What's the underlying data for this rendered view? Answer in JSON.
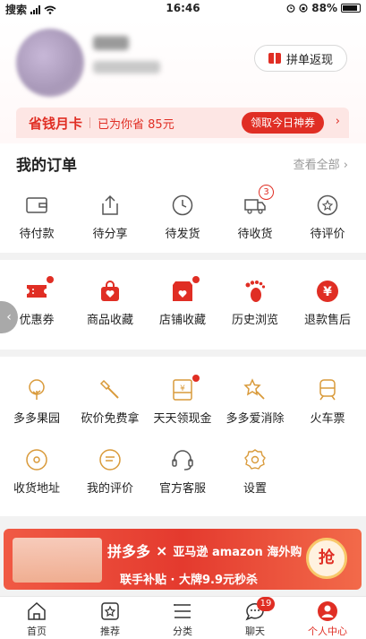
{
  "status": {
    "carrier": "搜索",
    "time": "16:46",
    "battery": "88%"
  },
  "header": {
    "pdd_button": "拼单返现"
  },
  "money_card": {
    "title": "省钱月卡",
    "saved": "已为你省 85元",
    "coupon_button": "领取今日神券",
    "chevron": "›"
  },
  "orders": {
    "title": "我的订单",
    "view_all": "查看全部 ›",
    "items": [
      {
        "label": "待付款",
        "icon": "wallet-icon"
      },
      {
        "label": "待分享",
        "icon": "share-icon"
      },
      {
        "label": "待发货",
        "icon": "clock-icon"
      },
      {
        "label": "待收货",
        "icon": "truck-icon",
        "badge": "3"
      },
      {
        "label": "待评价",
        "icon": "review-icon"
      }
    ]
  },
  "favorites": {
    "items": [
      {
        "label": "优惠券",
        "icon": "coupon-icon"
      },
      {
        "label": "商品收藏",
        "icon": "bag-heart-icon"
      },
      {
        "label": "店铺收藏",
        "icon": "shop-heart-icon"
      },
      {
        "label": "历史浏览",
        "icon": "footprint-icon"
      },
      {
        "label": "退款售后",
        "icon": "refund-icon"
      }
    ]
  },
  "services": {
    "items": [
      {
        "label": "多多果园",
        "icon": "tree-icon"
      },
      {
        "label": "砍价免费拿",
        "icon": "axe-icon"
      },
      {
        "label": "天天领现金",
        "icon": "cash-icon"
      },
      {
        "label": "多多爱消除",
        "icon": "star-wand-icon"
      },
      {
        "label": "火车票",
        "icon": "train-icon"
      },
      {
        "label": "收货地址",
        "icon": "location-icon"
      },
      {
        "label": "我的评价",
        "icon": "comment-icon"
      },
      {
        "label": "官方客服",
        "icon": "headset-icon"
      },
      {
        "label": "设置",
        "icon": "gear-icon"
      }
    ]
  },
  "side_handle": "‹",
  "banner": {
    "brand": "拼多多",
    "partner": "亚马逊 amazon 海外购",
    "subtitle": "联手补贴 · 大牌9.9元秒杀",
    "grab": "抢"
  },
  "tabbar": {
    "items": [
      {
        "label": "首页",
        "icon": "home-icon"
      },
      {
        "label": "推荐",
        "icon": "recommend-icon"
      },
      {
        "label": "分类",
        "icon": "category-icon"
      },
      {
        "label": "聊天",
        "icon": "chat-icon",
        "badge": "19"
      },
      {
        "label": "个人中心",
        "icon": "user-icon",
        "active": true
      }
    ]
  },
  "colors": {
    "accent": "#e02e24",
    "icon_orange": "#d99a3a",
    "icon_gray": "#555555"
  }
}
